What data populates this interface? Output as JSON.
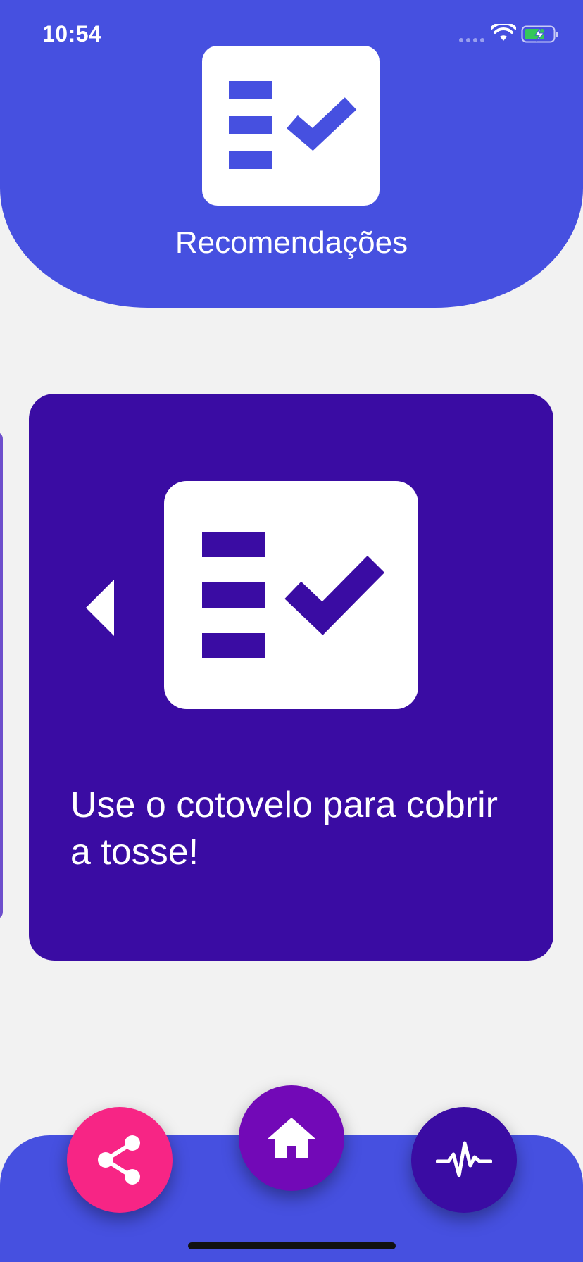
{
  "status_bar": {
    "time": "10:54"
  },
  "header": {
    "title": "Recomendações",
    "icon": "checklist-icon"
  },
  "card": {
    "icon": "checklist-icon",
    "text": "Use o cotovelo para cobrir a tosse!"
  },
  "bottom_nav": {
    "buttons": [
      {
        "icon": "share-icon",
        "color": "#f72585"
      },
      {
        "icon": "home-icon",
        "color": "#7209b7"
      },
      {
        "icon": "pulse-icon",
        "color": "#3a0ca3"
      }
    ]
  },
  "colors": {
    "primary": "#4650e0",
    "card": "#3a0ca3",
    "background": "#f2f2f2"
  }
}
